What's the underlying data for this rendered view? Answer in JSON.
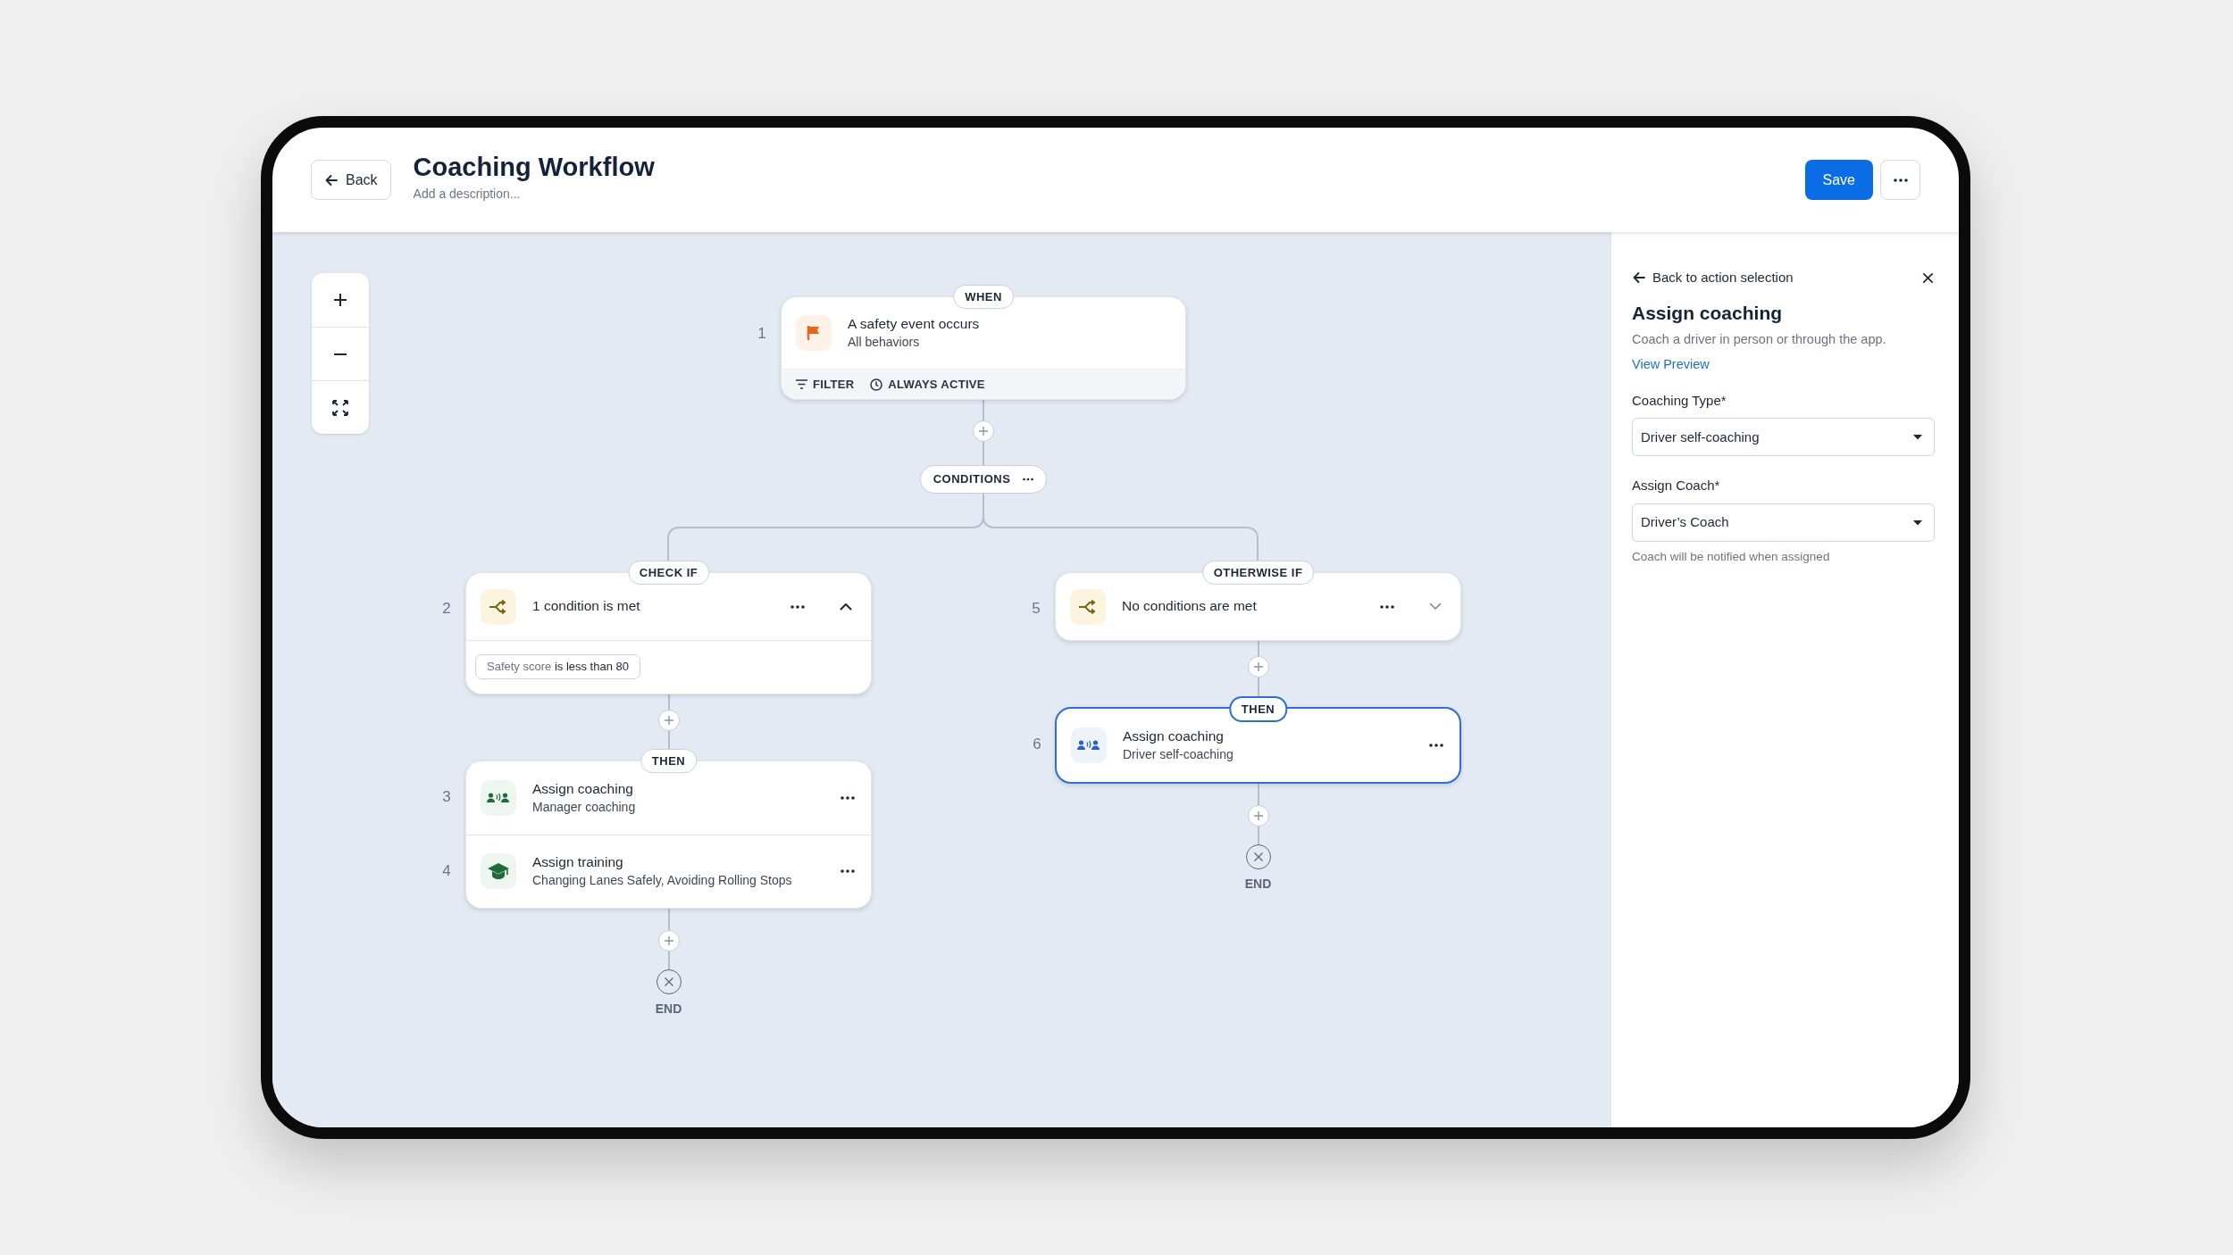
{
  "header": {
    "back": "Back",
    "title": "Coaching Workflow",
    "description_placeholder": "Add a description...",
    "save": "Save"
  },
  "trigger": {
    "badge": "WHEN",
    "number": "1",
    "title": "A safety event occurs",
    "subtitle": "All behaviors",
    "footer": [
      {
        "kind": "filter",
        "label": "FILTER"
      },
      {
        "kind": "schedule",
        "label": "ALWAYS ACTIVE"
      }
    ]
  },
  "conditions": {
    "label": "CONDITIONS"
  },
  "branches": [
    {
      "badge": "CHECK IF",
      "number": "2",
      "title": "1 condition is met",
      "expanded": true,
      "condition": {
        "field": "Safety score",
        "rule": "is less than 80"
      },
      "then_badge": "THEN",
      "actions": [
        {
          "number": "3",
          "kind": "coaching",
          "title": "Assign coaching",
          "subtitle": "Manager coaching",
          "selected": false
        },
        {
          "number": "4",
          "kind": "training",
          "title": "Assign training",
          "subtitle": "Changing Lanes Safely, Avoiding Rolling Stops",
          "selected": false
        }
      ],
      "end": "END"
    },
    {
      "badge": "OTHERWISE IF",
      "number": "5",
      "title": "No conditions are met",
      "expanded": false,
      "then_badge": "THEN",
      "actions": [
        {
          "number": "6",
          "kind": "coaching",
          "title": "Assign coaching",
          "subtitle": "Driver self-coaching",
          "selected": true
        }
      ],
      "end": "END"
    }
  ],
  "panel": {
    "back": "Back to action selection",
    "title": "Assign coaching",
    "description": "Coach a driver in person or through the app.",
    "link": "View Preview",
    "fields": [
      {
        "label": "Coaching Type*",
        "value": "Driver self-coaching"
      },
      {
        "label": "Assign Coach*",
        "value": "Driver’s Coach",
        "help": "Coach will be notified when assigned"
      }
    ]
  }
}
